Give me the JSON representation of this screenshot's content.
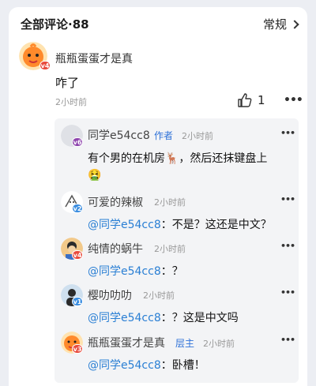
{
  "header": {
    "title": "全部评论·88",
    "sort_label": "常规"
  },
  "main_comment": {
    "author": "瓶瓶蛋蛋才是真",
    "level": "v4",
    "text": "咋了",
    "time": "2小时前",
    "like_count": "1"
  },
  "replies": [
    {
      "author": "同学e54cc8",
      "tag": "作者",
      "time": "2小时前",
      "level": "v6",
      "text_line1": "有个男的在机房🦌，然后还抹键盘上",
      "text_line2": "🤮"
    },
    {
      "author": "可爱的辣椒",
      "time": "2小时前",
      "level": "v2",
      "mention": "@同学e54cc8",
      "text": "：不是？这还是中文？"
    },
    {
      "author": "纯情的蜗牛",
      "time": "2小时前",
      "level": "v4",
      "mention": "@同学e54cc8",
      "text": "：？"
    },
    {
      "author": "樱叻叻叻",
      "time": "2小时前",
      "level": "v1",
      "mention": "@同学e54cc8",
      "text": "：？这是中文吗"
    },
    {
      "author": "瓶瓶蛋蛋才是真",
      "tag": "层主",
      "time": "2小时前",
      "level": "v3",
      "mention": "@同学e54cc8",
      "text": "：卧槽！"
    }
  ],
  "colors": {
    "accent_blue": "#2f72d8",
    "mention_blue": "#2a7fd4"
  }
}
